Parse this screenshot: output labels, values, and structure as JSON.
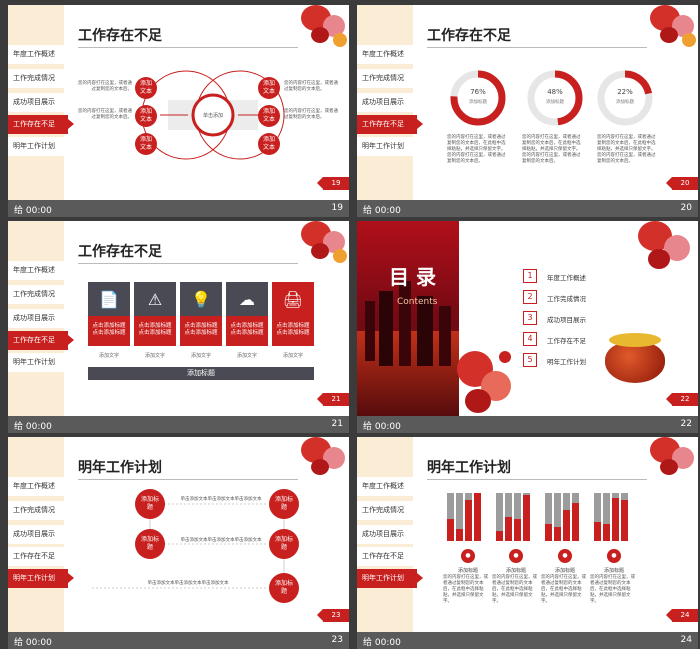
{
  "time_label": "给 00:00",
  "sidebar_items": [
    "年度工作概述",
    "工作完成情况",
    "成功项目展示",
    "工作存在不足",
    "明年工作计划"
  ],
  "placeholder_text": "您的内容打在这里，或者通过复制您的文本后。",
  "slides": [
    {
      "number": "19",
      "title": "工作存在不足",
      "center_label": "单击添加",
      "node_label": "添加文本",
      "side_text_left": [
        "您的内容打在这里，或者通过复制您的文本后。",
        "您的内容打在这里，或者通过复制您的文本后。"
      ],
      "side_text_right": [
        "您的内容打在这里，或者通过复制您的文本后。",
        "您的内容打在这里，或者通过复制您的文本后。"
      ]
    },
    {
      "number": "20",
      "title": "工作存在不足",
      "rings": [
        {
          "percent": "76%",
          "label": "添加标题",
          "value": 0.76
        },
        {
          "percent": "48%",
          "label": "添加标题",
          "value": 0.48
        },
        {
          "percent": "22%",
          "label": "添加标题",
          "value": 0.22
        }
      ],
      "ring_text": "您的内容打在这里，或者通过复制您的文本后，在此框中选择粘贴，并选择只保留文字。您的内容打在这里，或者通过复制您的文本后。"
    },
    {
      "number": "21",
      "title": "工作存在不足",
      "card_text": [
        "点击添加标题",
        "点击添加标题"
      ],
      "card_label": "添加文字",
      "card_icons": [
        "📄",
        "⚠",
        "💡",
        "☁",
        "🖨"
      ],
      "footer_label": "添加标题"
    },
    {
      "number": "22",
      "toc_title": "目 录",
      "toc_sub": "Contents",
      "toc_items": [
        {
          "n": "1",
          "label": "年度工作概述"
        },
        {
          "n": "2",
          "label": "工作完成情况"
        },
        {
          "n": "3",
          "label": "成功项目展示"
        },
        {
          "n": "4",
          "label": "工作存在不足"
        },
        {
          "n": "5",
          "label": "明年工作计划"
        }
      ]
    },
    {
      "number": "23",
      "title": "明年工作计划",
      "node_label": "添加标题",
      "flow_text": "单击添加文本单击添加文本单击添加文本"
    },
    {
      "number": "24",
      "title": "明年工作计划",
      "bar_label": "添加标题",
      "bar_groups": [
        {
          "grey": [
            1,
            1,
            1,
            1
          ],
          "red": [
            0.45,
            0.25,
            0.85,
            1
          ]
        },
        {
          "grey": [
            1,
            1,
            1,
            1
          ],
          "red": [
            0.2,
            0.5,
            0.45,
            0.95
          ]
        },
        {
          "grey": [
            1,
            1,
            1,
            1
          ],
          "red": [
            0.35,
            0.3,
            0.65,
            0.8
          ]
        },
        {
          "grey": [
            1,
            1,
            1,
            1
          ],
          "red": [
            0.4,
            0.35,
            0.9,
            0.85
          ]
        }
      ],
      "bar_text": "您的内容打在这里，或者通过复制您的文本后，在此框中选择粘贴，并选择只保留文字。"
    }
  ],
  "colors": {
    "accent": "#c8201e",
    "sidebar_bg": "#fbecd6",
    "card_dark": "#4a4a55"
  }
}
